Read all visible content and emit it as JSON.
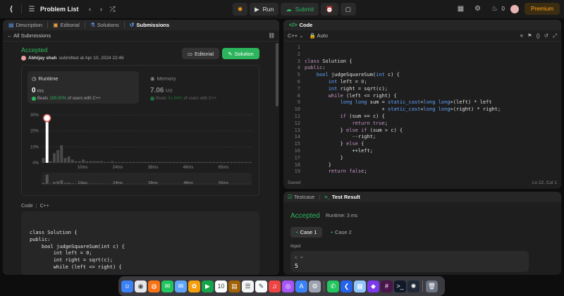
{
  "topbar": {
    "title": "Problem List",
    "run_label": "Run",
    "submit_label": "Submit",
    "notif_count": "0",
    "premium_label": "Premium",
    "colors": {
      "accent": "#2db55d",
      "premium": "#ffa116"
    }
  },
  "left_tabs": [
    {
      "label": "Description",
      "icon": "description-icon"
    },
    {
      "label": "Editorial",
      "icon": "book-icon"
    },
    {
      "label": "Solutions",
      "icon": "flask-icon"
    },
    {
      "label": "Submissions",
      "icon": "history-icon"
    }
  ],
  "submission": {
    "back_label": "All Submissions",
    "status": "Accepted",
    "author": "Abhijay shah",
    "submitted_text": "submitted at Apr 10, 2024 22:46",
    "editorial_button": "Editorial",
    "solution_button": "Solution",
    "runtime": {
      "title": "Runtime",
      "value": "0",
      "unit": "ms",
      "beats_prefix": "Beats",
      "beats_pct": "100.00%",
      "beats_suffix": "of users with C++"
    },
    "memory": {
      "title": "Memory",
      "value": "7.06",
      "unit": "MB",
      "beats_prefix": "Beats",
      "beats_pct": "41.64%",
      "beats_suffix": "of users with C++"
    },
    "code_lang_label": "Code",
    "code_lang": "C++",
    "code_lines": [
      "class Solution {",
      "public:",
      "    bool judgeSquareSum(int c) {",
      "        int left = 0;",
      "        int right = sqrt(c);",
      "        while (left <= right) {"
    ]
  },
  "chart_data": {
    "type": "bar",
    "title": "",
    "y_tick_labels": [
      "30%",
      "20%",
      "10%",
      "0%"
    ],
    "x_tick_labels": [
      "10ms",
      "24ms",
      "38ms",
      "48ms",
      "65ms"
    ],
    "ylim": [
      0,
      30
    ],
    "values": [
      3,
      28,
      1,
      6,
      8,
      11,
      3,
      4,
      2,
      1,
      1,
      2,
      1,
      1,
      1,
      1,
      1,
      0.5,
      0.5,
      1,
      0.5,
      0.5,
      0.5,
      0.5,
      0.5,
      0.5,
      0.5,
      0.5,
      0.5,
      0.5,
      0.5,
      0.5,
      0.5,
      0.5,
      0.5,
      0.5,
      0.5,
      0.5,
      0.5,
      0.5,
      0.5,
      0.5,
      0.5,
      0.5,
      0.5,
      0.5,
      0.5,
      0.5,
      0.5,
      0.5,
      0.5,
      0.5,
      0.5,
      0.5,
      0.5,
      0.5,
      0.5,
      0.5
    ],
    "highlight_index": 1,
    "bar_color": "#4a4a4a",
    "highlight_color": "#ffffff"
  },
  "code_panel": {
    "title": "Code",
    "language": "C++",
    "mode": "Auto",
    "status_left": "Saved",
    "status_right": "Ln 22, Col 1",
    "lines": [
      "",
      "",
      "class Solution {",
      "public:",
      "    bool judgeSquareSum(int c) {",
      "        int left = 0;",
      "        int right = sqrt(c);",
      "        while (left <= right) {",
      "            long long sum = static_cast<long long>(left) * left",
      "                          + static_cast<long long>(right) * right;",
      "            if (sum == c) {",
      "                return true;",
      "            } else if (sum > c) {",
      "                --right;",
      "            } else {",
      "                ++left;",
      "            }",
      "        }",
      "        return false;"
    ]
  },
  "test_panel": {
    "tab_testcase": "Testcase",
    "tab_result": "Test Result",
    "status": "Accepted",
    "runtime_text": "Runtime: 3 ms",
    "cases": [
      "Case 1",
      "Case 2"
    ],
    "input_label": "Input",
    "input_var": "c =",
    "input_value": "5"
  },
  "dock": {
    "apps": [
      {
        "name": "finder-icon",
        "color": "#3b82f6",
        "glyph": "☺"
      },
      {
        "name": "chrome-icon",
        "color": "#e5e7eb",
        "glyph": "◉"
      },
      {
        "name": "firefox-icon",
        "color": "#f97316",
        "glyph": "◍"
      },
      {
        "name": "messages-icon",
        "color": "#22c55e",
        "glyph": "✉"
      },
      {
        "name": "mail-icon",
        "color": "#60a5fa",
        "glyph": "✉"
      },
      {
        "name": "photos-icon",
        "color": "#f59e0b",
        "glyph": "✿"
      },
      {
        "name": "facetime-icon",
        "color": "#16a34a",
        "glyph": "▶"
      },
      {
        "name": "calendar-icon",
        "color": "#ffffff",
        "glyph": "10"
      },
      {
        "name": "notes-icon",
        "color": "#a16207",
        "glyph": "▤"
      },
      {
        "name": "reminders-icon",
        "color": "#f3f4f6",
        "glyph": "☰"
      },
      {
        "name": "freeform-icon",
        "color": "#f9fafb",
        "glyph": "✎"
      },
      {
        "name": "music-icon",
        "color": "#ef4444",
        "glyph": "♫"
      },
      {
        "name": "podcasts-icon",
        "color": "#a855f7",
        "glyph": "◎"
      },
      {
        "name": "appstore-icon",
        "color": "#3b82f6",
        "glyph": "A"
      },
      {
        "name": "settings-icon",
        "color": "#9ca3af",
        "glyph": "⚙"
      },
      {
        "name": "whatsapp-icon",
        "color": "#22c55e",
        "glyph": "✆"
      },
      {
        "name": "vscode-icon",
        "color": "#2563eb",
        "glyph": "❮"
      },
      {
        "name": "preview-icon",
        "color": "#93c5fd",
        "glyph": "▦"
      },
      {
        "name": "obsidian-icon",
        "color": "#7c3aed",
        "glyph": "◆"
      },
      {
        "name": "slack-icon",
        "color": "#4a154b",
        "glyph": "#"
      },
      {
        "name": "terminal-icon",
        "color": "#111827",
        "glyph": ">_"
      },
      {
        "name": "chatgpt-icon",
        "color": "#1f2937",
        "glyph": "✺"
      },
      {
        "name": "trash-icon",
        "color": "#6b7280",
        "glyph": "🗑"
      }
    ]
  }
}
